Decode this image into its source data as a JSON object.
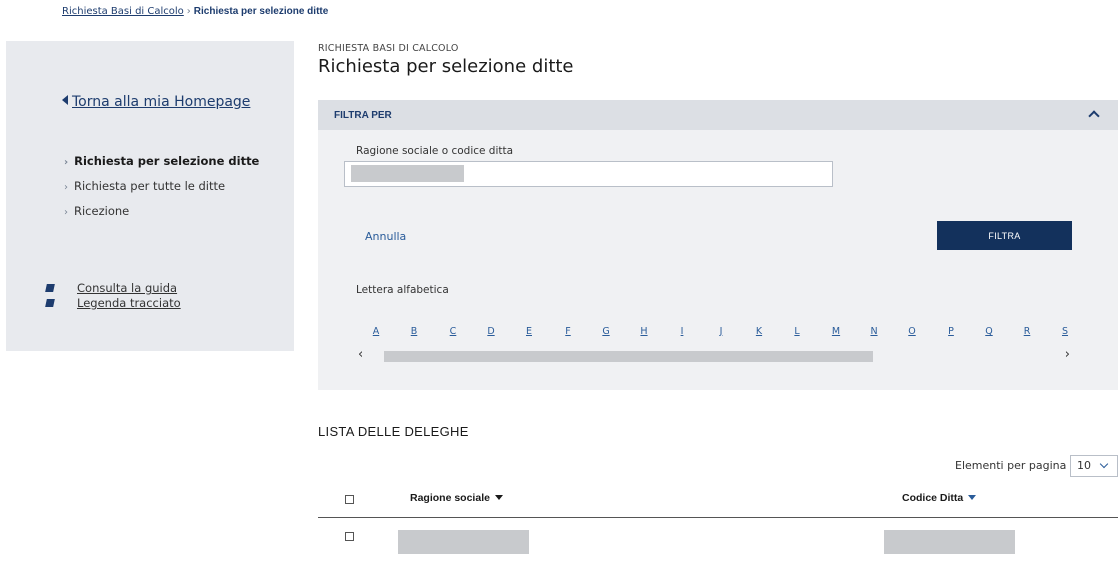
{
  "breadcrumb": {
    "link": "Richiesta Basi di Calcolo",
    "separator": "›",
    "current": "Richiesta per selezione ditte"
  },
  "sidebar": {
    "home_link": "Torna alla mia Homepage",
    "nav": [
      {
        "label": "Richiesta per selezione ditte",
        "active": true
      },
      {
        "label": "Richiesta per tutte le ditte",
        "active": false
      },
      {
        "label": "Ricezione",
        "active": false
      }
    ],
    "links": [
      {
        "label": "Consulta la guida",
        "icon": "book-icon"
      },
      {
        "label": "Legenda tracciato",
        "icon": "book-icon"
      }
    ]
  },
  "page": {
    "subtitle": "RICHIESTA BASI DI CALCOLO",
    "title": "Richiesta per selezione ditte"
  },
  "filter": {
    "header": "FILTRA PER",
    "field_label": "Ragione sociale o codice ditta",
    "cancel_label": "Annulla",
    "submit_label": "FILTRA",
    "letter_label": "Lettera alfabetica",
    "letters": [
      "A",
      "B",
      "C",
      "D",
      "E",
      "F",
      "G",
      "H",
      "I",
      "J",
      "K",
      "L",
      "M",
      "N",
      "O",
      "P",
      "Q",
      "R",
      "S"
    ],
    "scroll_left": "‹",
    "scroll_right": "›"
  },
  "list": {
    "title": "LISTA DELLE DELEGHE",
    "per_page_label": "Elementi per pagina",
    "per_page_value": "10",
    "columns": [
      "Ragione sociale",
      "Codice Ditta"
    ]
  },
  "colors": {
    "primary": "#13315c",
    "link": "#2a5c9a",
    "sidebar_bg": "#e8eaee",
    "panel_bg": "#f0f1f3"
  }
}
